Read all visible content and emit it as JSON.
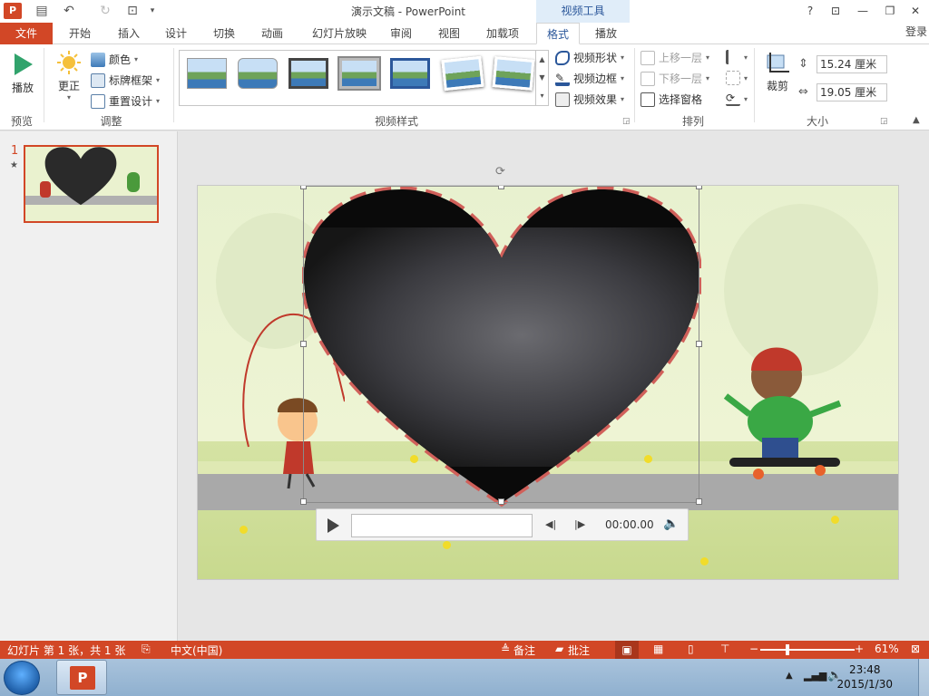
{
  "window": {
    "title": "演示文稿 - PowerPoint",
    "context_tool": "视频工具"
  },
  "qat": {
    "save": "save-icon",
    "undo": "undo-icon",
    "redo": "redo-icon",
    "start": "present-icon"
  },
  "tabs": [
    {
      "label": "文件"
    },
    {
      "label": "开始"
    },
    {
      "label": "插入"
    },
    {
      "label": "设计"
    },
    {
      "label": "切换"
    },
    {
      "label": "动画"
    },
    {
      "label": "幻灯片放映"
    },
    {
      "label": "审阅"
    },
    {
      "label": "视图"
    },
    {
      "label": "加载项"
    },
    {
      "label": "格式"
    },
    {
      "label": "播放"
    }
  ],
  "login": "登录",
  "help": "?",
  "ribbon": {
    "preview": {
      "play": "播放",
      "group": "预览"
    },
    "adjust": {
      "correct": "更正",
      "color": "颜色",
      "poster": "标牌框架",
      "reset": "重置设计",
      "group": "调整"
    },
    "styles": {
      "group": "视频样式",
      "shape": "视频形状",
      "border": "视频边框",
      "effects": "视频效果"
    },
    "arrange": {
      "forward": "上移一层",
      "backward": "下移一层",
      "selection": "选择窗格",
      "group": "排列"
    },
    "size": {
      "crop": "裁剪",
      "height": "15.24 厘米",
      "width": "19.05 厘米",
      "group": "大小"
    }
  },
  "thumbnails": {
    "slide_number": "1",
    "star": "★"
  },
  "video": {
    "time": "00:00.00"
  },
  "status": {
    "slide_info": "幻灯片 第 1 张，共 1 张",
    "language": "中文(中国)",
    "notes": "备注",
    "comments": "批注",
    "zoom": "61%",
    "zoom_minus": "−",
    "zoom_plus": "+"
  },
  "taskbar": {
    "time": "23:48",
    "date": "2015/1/30"
  },
  "colors": {
    "accent": "#d24726",
    "context": "#2b579a"
  }
}
